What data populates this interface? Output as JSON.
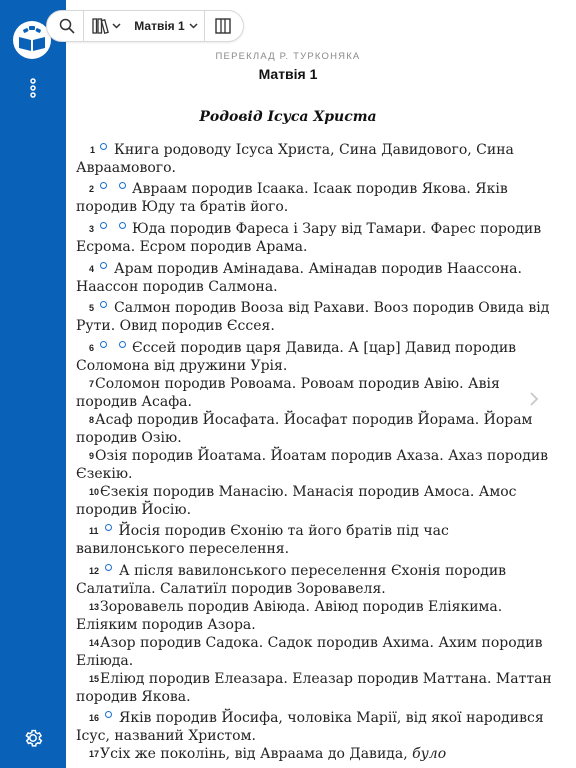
{
  "app": {
    "logo_icon": "open-book-logo-icon",
    "more_icon": "vertical-dots-icon",
    "settings_icon": "gear-icon",
    "accent": "#0a62b8",
    "footnote_marker_color": "#1a6fd0"
  },
  "toolbar": {
    "search_icon": "search-icon",
    "books_icon": "books-icon",
    "chapter_label": "Матвія 1",
    "panel_icon": "two-column-icon"
  },
  "reader": {
    "translation": "ПЕРЕКЛАД Р. ТУРКОНЯКА",
    "chapter_title": "Матвія 1",
    "section_heading": "Родовід Ісуса Христа",
    "next_icon": "chevron-right-icon",
    "verses": [
      {
        "num": "1",
        "l1": "Книга родоводу Ісуса Христа, Сина Давидового, Сина",
        "l2": "Авраамового."
      },
      {
        "num": "2",
        "l1": "Авраам породив Ісаака. Ісаак породив Якова. Яків",
        "l2": "породив Юду та братів його."
      },
      {
        "num": "3",
        "l1": "Юда породив Фареса і Зару від Тамари. Фарес породив",
        "l2": "Есрома. Есром породив Арама."
      },
      {
        "num": "4",
        "l1": "Арам породив Амінадава. Амінадав породив Наассона.",
        "l2": "Наассон породив Салмона."
      },
      {
        "num": "5",
        "l1": "Салмон породив Вооза від Рахави. Вооз породив Овида від",
        "l2": "Рути. Овид породив Єссея."
      },
      {
        "num": "6",
        "l1": "Єссей породив царя Давида. А [цар] Давид породив",
        "l2": "Соломона від дружини Урія."
      },
      {
        "num": "7",
        "l1": "Соломон породив Ровоама. Ровоам породив Авію. Авія",
        "l2": "породив Асафа."
      },
      {
        "num": "8",
        "l1": "Асаф породив Йосафата. Йосафат породив Йорама. Йорам",
        "l2": "породив Озію."
      },
      {
        "num": "9",
        "l1": "Озія породив Йоатама. Йоатам породив Ахаза. Ахаз породив",
        "l2": "Єзекію."
      },
      {
        "num": "10",
        "l1": "Єзекія породив Манасію. Манасія породив Амоса. Амос",
        "l2": "породив Йосію."
      },
      {
        "num": "11",
        "l1": "Йосія породив Єхонію та його братів під час",
        "l2": "вавилонського переселення."
      },
      {
        "num": "12",
        "l1": "А після вавилонського переселення Єхонія породив",
        "l2": "Салатиїла. Салатиїл породив Зоровавеля."
      },
      {
        "num": "13",
        "l1": "Зоровавель породив Авіюда. Авіюд породив Еліякима.",
        "l2": "Еліяким породив Азора."
      },
      {
        "num": "14",
        "l1": "Азор породив Садока. Садок породив Ахима. Ахим породив",
        "l2": "Еліюда."
      },
      {
        "num": "15",
        "l1": "Еліюд породив Елеазара. Елеазар породив Маттана. Маттан",
        "l2": "породив Якова."
      },
      {
        "num": "16",
        "l1": "Яків породив Йосифа, чоловіка Марії, від якої народився",
        "l2": "Ісус, названий Христом."
      },
      {
        "num": "17",
        "l1": "Усіх же поколінь, від Авраама до Давида,",
        "l1_italic": "було"
      }
    ]
  }
}
